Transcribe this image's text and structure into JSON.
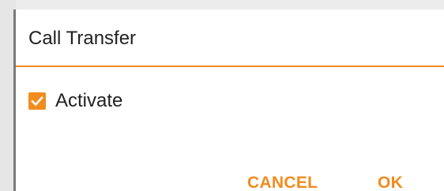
{
  "dialog": {
    "title": "Call Transfer",
    "checkbox": {
      "label": "Activate",
      "checked": true
    },
    "buttons": {
      "cancel": "CANCEL",
      "ok": "OK"
    }
  },
  "colors": {
    "accent": "#f28c1f",
    "text": "#212121",
    "dialog_background": "#ffffff",
    "scrim": "#9a9a9a"
  },
  "icons": {
    "checkbox": "checkmark-icon"
  }
}
